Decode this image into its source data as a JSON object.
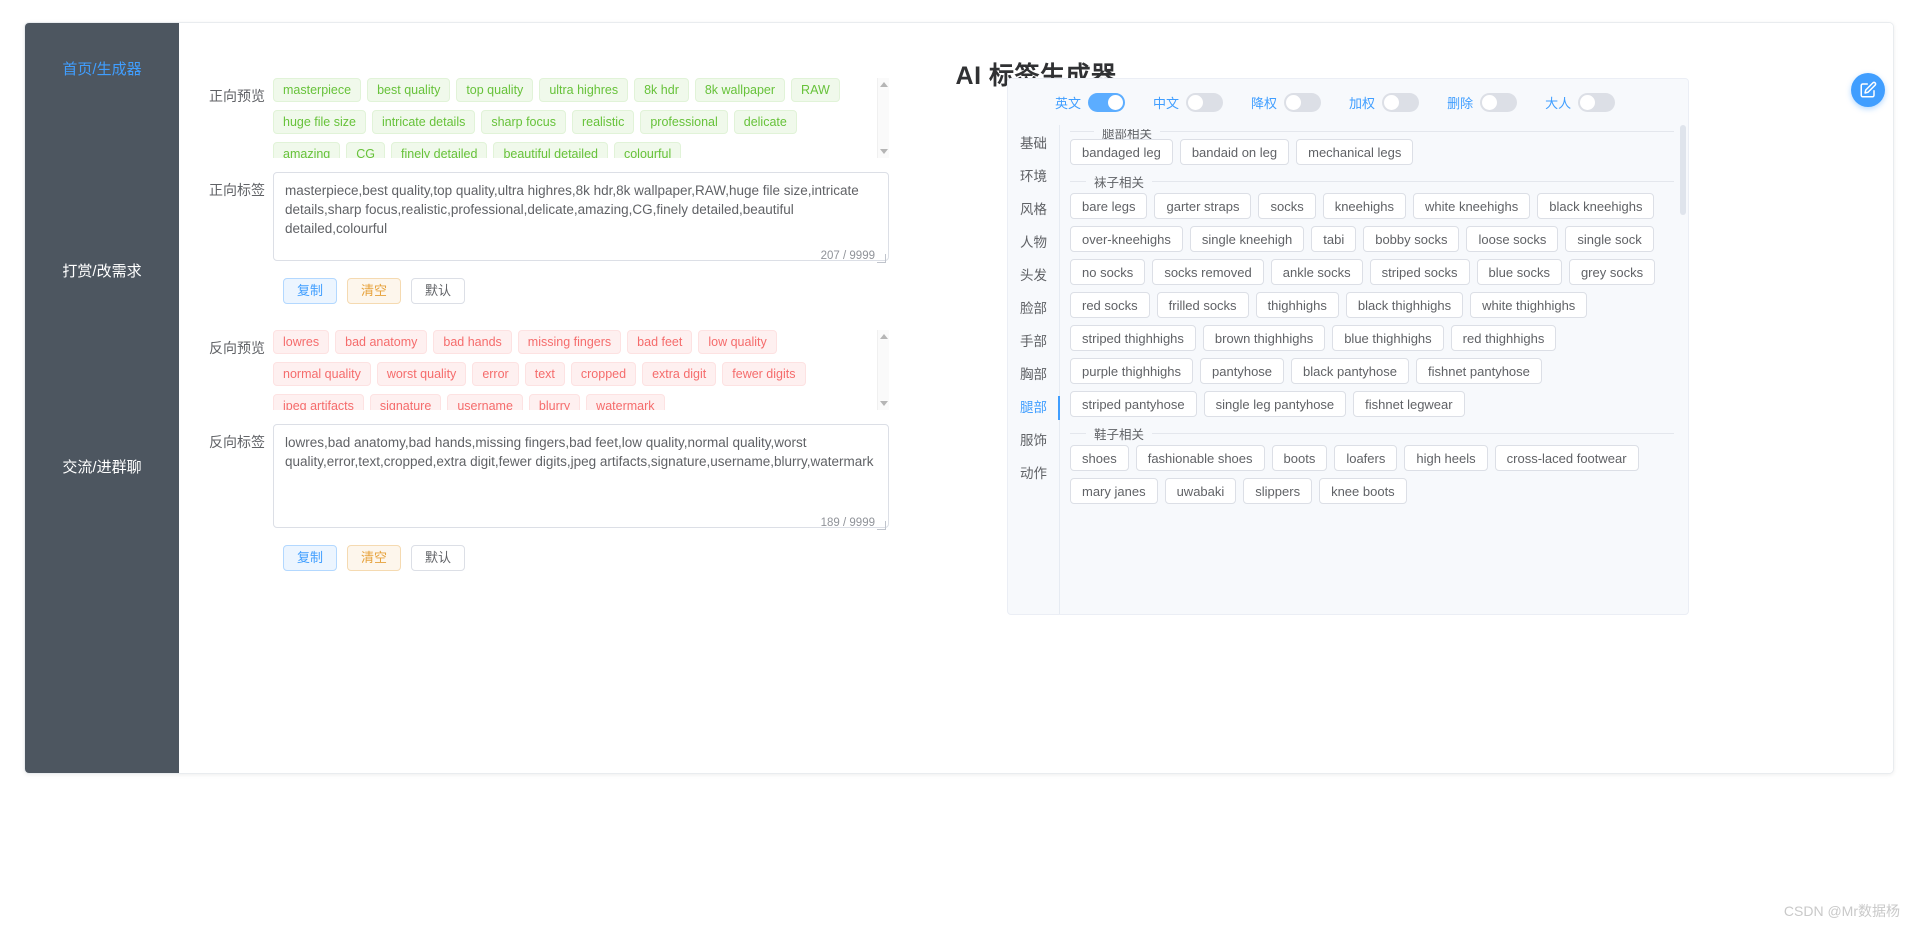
{
  "app": {
    "title": "AI 标签生成器",
    "watermark": "CSDN @Mr数据杨"
  },
  "sidebar": {
    "items": [
      {
        "label": "首页/生成器",
        "active": true
      },
      {
        "label": "打赏/改需求",
        "active": false
      },
      {
        "label": "交流/进群聊",
        "active": false
      }
    ]
  },
  "positive": {
    "preview_label": "正向预览",
    "tags_label": "正向标签",
    "chips": [
      "masterpiece",
      "best quality",
      "top quality",
      "ultra highres",
      "8k hdr",
      "8k wallpaper",
      "RAW",
      "huge file size",
      "intricate details",
      "sharp focus",
      "realistic",
      "professional",
      "delicate",
      "amazing",
      "CG",
      "finely detailed",
      "beautiful detailed",
      "colourful"
    ],
    "textarea_value": "masterpiece,best quality,top quality,ultra highres,8k hdr,8k wallpaper,RAW,huge file size,intricate details,sharp focus,realistic,professional,delicate,amazing,CG,finely detailed,beautiful detailed,colourful",
    "counter": "207 / 9999",
    "buttons": {
      "copy": "复制",
      "clear": "清空",
      "default": "默认"
    }
  },
  "negative": {
    "preview_label": "反向预览",
    "tags_label": "反向标签",
    "chips": [
      "lowres",
      "bad anatomy",
      "bad hands",
      "missing fingers",
      "bad feet",
      "low quality",
      "normal quality",
      "worst quality",
      "error",
      "text",
      "cropped",
      "extra digit",
      "fewer digits",
      "jpeg artifacts",
      "signature",
      "username",
      "blurry",
      "watermark"
    ],
    "textarea_value": "lowres,bad anatomy,bad hands,missing fingers,bad feet,low quality,normal quality,worst quality,error,text,cropped,extra digit,fewer digits,jpeg artifacts,signature,username,blurry,watermark",
    "counter": "189 / 9999",
    "buttons": {
      "copy": "复制",
      "clear": "清空",
      "default": "默认"
    }
  },
  "right_panel": {
    "toggles": [
      {
        "label": "英文",
        "on": true
      },
      {
        "label": "中文",
        "on": false
      },
      {
        "label": "降权",
        "on": false
      },
      {
        "label": "加权",
        "on": false
      },
      {
        "label": "删除",
        "on": false
      },
      {
        "label": "大人",
        "on": false
      }
    ],
    "tabs": [
      {
        "label": "基础",
        "active": false
      },
      {
        "label": "环境",
        "active": false
      },
      {
        "label": "风格",
        "active": false
      },
      {
        "label": "人物",
        "active": false
      },
      {
        "label": "头发",
        "active": false
      },
      {
        "label": "脸部",
        "active": false
      },
      {
        "label": "手部",
        "active": false
      },
      {
        "label": "胸部",
        "active": false
      },
      {
        "label": "腿部",
        "active": true
      },
      {
        "label": "服饰",
        "active": false
      },
      {
        "label": "动作",
        "active": false
      }
    ],
    "groups": [
      {
        "title": "腿部相关",
        "clipped": true,
        "tags": [
          "bandaged leg",
          "bandaid on leg",
          "mechanical legs"
        ]
      },
      {
        "title": "袜子相关",
        "clipped": false,
        "tags": [
          "bare legs",
          "garter straps",
          "socks",
          "kneehighs",
          "white kneehighs",
          "black kneehighs",
          "over-kneehighs",
          "single kneehigh",
          "tabi",
          "bobby socks",
          "loose socks",
          "single sock",
          "no socks",
          "socks removed",
          "ankle socks",
          "striped socks",
          "blue socks",
          "grey socks",
          "red socks",
          "frilled socks",
          "thighhighs",
          "black thighhighs",
          "white thighhighs",
          "striped thighhighs",
          "brown thighhighs",
          "blue thighhighs",
          "red thighhighs",
          "purple thighhighs",
          "pantyhose",
          "black pantyhose",
          "fishnet pantyhose",
          "striped pantyhose",
          "single leg pantyhose",
          "fishnet legwear"
        ]
      },
      {
        "title": "鞋子相关",
        "clipped": false,
        "tags": [
          "shoes",
          "fashionable shoes",
          "boots",
          "loafers",
          "high heels",
          "cross-laced footwear",
          "mary janes",
          "uwabaki",
          "slippers",
          "knee boots"
        ]
      }
    ],
    "fab_icon": "edit-square-icon"
  },
  "colors": {
    "accent": "#409eff",
    "positive_chip": "#67c23a",
    "negative_chip": "#f56c6c",
    "sidebar_bg": "#4d5660"
  }
}
